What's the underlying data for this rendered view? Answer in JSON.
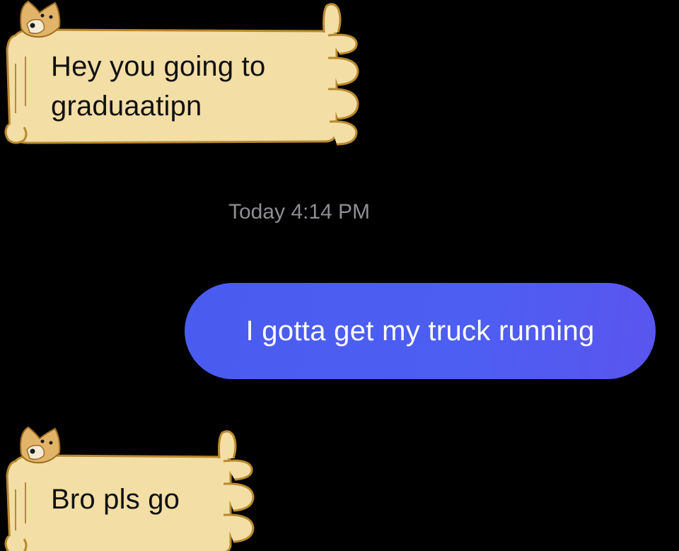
{
  "conversation": {
    "messages": [
      {
        "direction": "incoming",
        "theme": "doge-scroll",
        "text": "Hey you going to graduaatipn"
      },
      {
        "direction": "timestamp",
        "text": "Today 4:14 PM"
      },
      {
        "direction": "outgoing",
        "text": "I gotta get my truck running"
      },
      {
        "direction": "incoming",
        "theme": "doge-scroll",
        "text": "Bro pls go"
      }
    ]
  },
  "colors": {
    "background": "#000000",
    "outgoing_bubble": "#4a5cf0",
    "outgoing_text": "#ffffff",
    "incoming_bubble": "#f3dea6",
    "incoming_outline": "#b8892e",
    "incoming_text": "#111111",
    "timestamp_text": "#8e8e93"
  }
}
